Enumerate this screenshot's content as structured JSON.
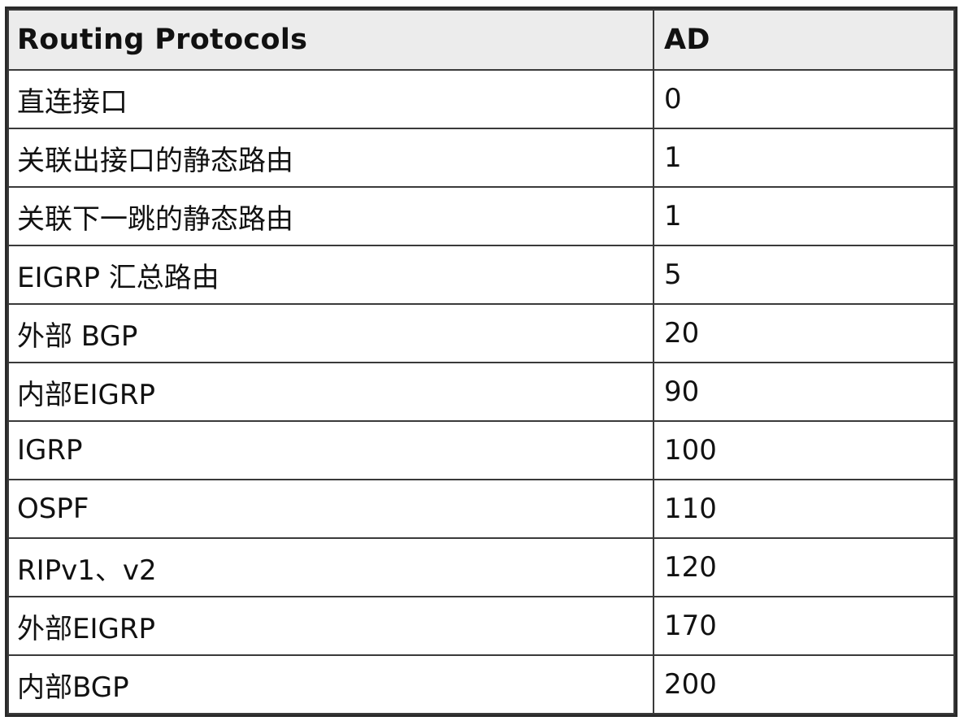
{
  "table": {
    "headers": {
      "protocol": "Routing Protocols",
      "ad": "AD"
    },
    "rows": [
      {
        "protocol": "直连接口",
        "ad": "0"
      },
      {
        "protocol": "关联出接口的静态路由",
        "ad": "1"
      },
      {
        "protocol": "关联下一跳的静态路由",
        "ad": "1"
      },
      {
        "protocol": "EIGRP 汇总路由",
        "ad": "5"
      },
      {
        "protocol": "外部 BGP",
        "ad": "20"
      },
      {
        "protocol": "内部EIGRP",
        "ad": "90"
      },
      {
        "protocol": "IGRP",
        "ad": "100"
      },
      {
        "protocol": "OSPF",
        "ad": "110"
      },
      {
        "protocol": "RIPv1、v2",
        "ad": "120"
      },
      {
        "protocol": "外部EIGRP",
        "ad": "170"
      },
      {
        "protocol": "内部BGP",
        "ad": "200"
      }
    ]
  },
  "colors": {
    "header_bg": "#ececec",
    "border": "#3a3a3a",
    "text": "#111111"
  }
}
